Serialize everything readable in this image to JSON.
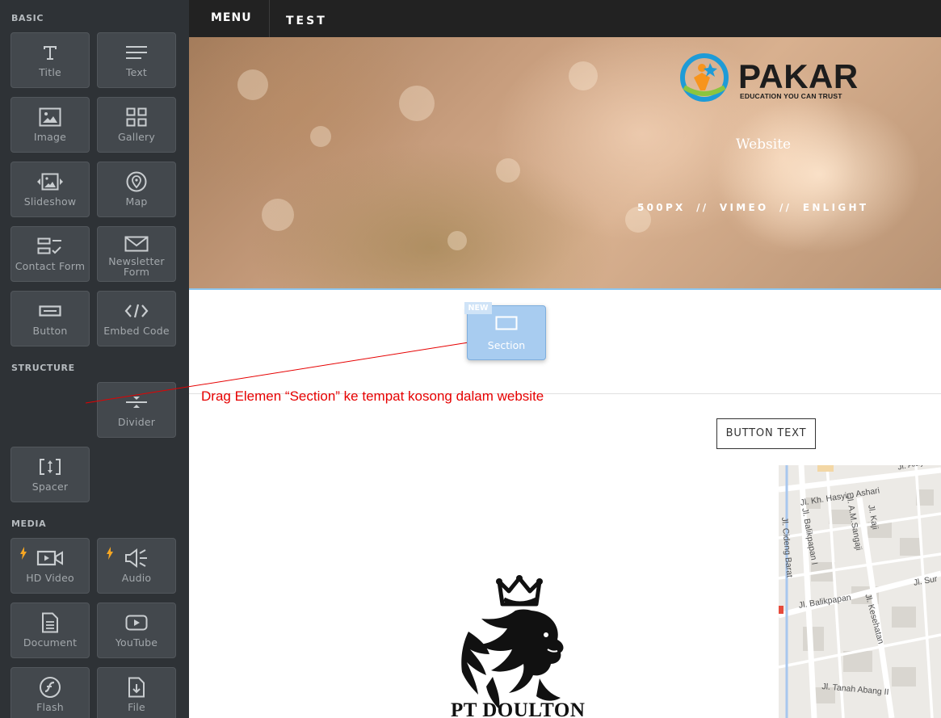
{
  "sidebar": {
    "sections": {
      "basic": "BASIC",
      "structure": "STRUCTURE",
      "media": "MEDIA"
    },
    "items": [
      {
        "label": "Title",
        "icon": "title-icon"
      },
      {
        "label": "Text",
        "icon": "text-lines-icon"
      },
      {
        "label": "Image",
        "icon": "image-icon"
      },
      {
        "label": "Gallery",
        "icon": "gallery-grid-icon"
      },
      {
        "label": "Slideshow",
        "icon": "slideshow-icon"
      },
      {
        "label": "Map",
        "icon": "map-pin-icon"
      },
      {
        "label": "Contact Form",
        "icon": "contact-form-icon"
      },
      {
        "label": "Newsletter Form",
        "icon": "envelope-icon"
      },
      {
        "label": "Button",
        "icon": "button-icon"
      },
      {
        "label": "Embed Code",
        "icon": "code-icon"
      },
      {
        "label": "Divider",
        "icon": "divider-icon"
      },
      {
        "label": "Spacer",
        "icon": "spacer-icon"
      },
      {
        "label": "HD Video",
        "icon": "video-camera-icon"
      },
      {
        "label": "Audio",
        "icon": "speaker-icon"
      },
      {
        "label": "Document",
        "icon": "document-icon"
      },
      {
        "label": "YouTube",
        "icon": "youtube-icon"
      },
      {
        "label": "Flash",
        "icon": "flash-icon"
      },
      {
        "label": "File",
        "icon": "file-download-icon"
      }
    ]
  },
  "topbar": {
    "menu_label": "MENU",
    "site_name": "TEST"
  },
  "hero": {
    "logo_name": "PAKAR",
    "logo_tagline": "EDUCATION YOU CAN TRUST",
    "title": "Website",
    "links": "500PX // VIMEO // ENLIGHT"
  },
  "dragged": {
    "badge": "NEW",
    "label": "Section"
  },
  "instruction": "Drag Elemen “Section” ke tempat kosong dalam website",
  "content": {
    "button_text": "BUTTON TEXT",
    "company_name": "PT DOULTON"
  },
  "map": {
    "streets": [
      "Jl. Alay",
      "Jl. Kh. Hasyim Ashari",
      "Jl. Balikpapan I",
      "Jl. A.M.Sangaji",
      "Jl. Kaji",
      "Jl. Cideng Barat",
      "Jl. Sur",
      "Jl. Balikpapan",
      "Jl. Kesehatan",
      "Jl. Tanah Abang II"
    ]
  },
  "colors": {
    "sidebar_bg": "#2e3236",
    "tile_bg": "#43484d",
    "topbar_bg": "#222222",
    "accent_blue": "#8cc5ee",
    "instruction_red": "#e60000",
    "bolt_orange": "#f5a623"
  }
}
